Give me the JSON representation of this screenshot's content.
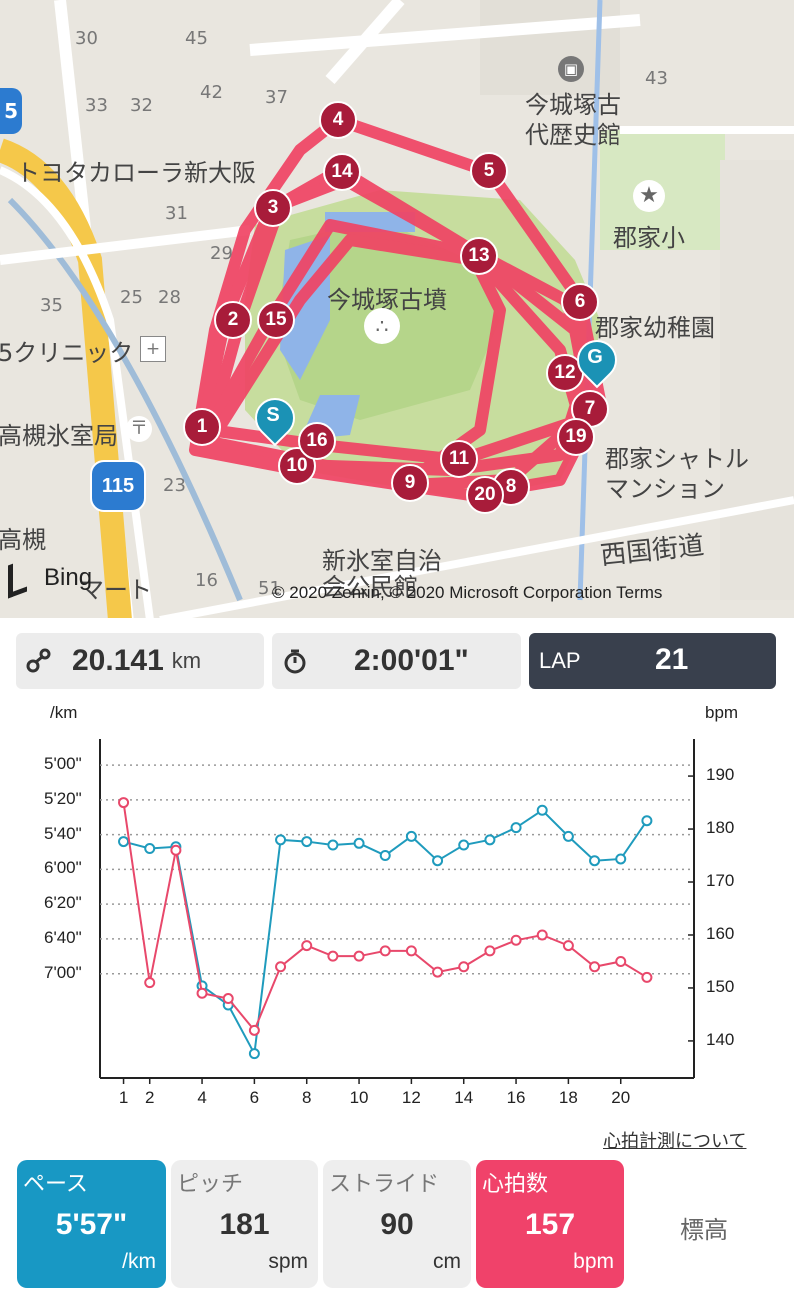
{
  "map": {
    "labels": {
      "num_30": "30",
      "num_45": "45",
      "num_43": "43",
      "num_33": "33",
      "num_32": "32",
      "num_42": "42",
      "num_37": "37",
      "num_31": "31",
      "num_29": "29",
      "num_35": "35",
      "num_25": "25",
      "num_28": "28",
      "num_23": "23",
      "num_16": "16",
      "num_51": "51",
      "num_5": "5",
      "toyota": "トヨタカローラ新大阪",
      "museum": "今城塚古\n代歴史館",
      "kofun": "今城塚古墳",
      "school": "郡家小",
      "kindergarten": "郡家幼稚園",
      "clinic": "5クリニック",
      "post": "高槻氷室局",
      "shuttle": "郡家シャトル\nマンション",
      "saigoku": "西国街道",
      "jichikai": "新氷室自治\n会公民館",
      "mart": "マート",
      "takatsuki": "高槻",
      "route": "115"
    },
    "bing": "Bing",
    "copyright": "© 2020 Zenrin, © 2020 Microsoft Corporation  Terms",
    "markers": [
      "1",
      "2",
      "3",
      "4",
      "5",
      "6",
      "7",
      "8",
      "9",
      "10",
      "11",
      "12",
      "13",
      "14",
      "15",
      "16",
      "19",
      "20"
    ],
    "start_label": "S",
    "goal_label": "G"
  },
  "stats": {
    "distance_icon": "route-icon",
    "distance": "20.141",
    "distance_unit": "km",
    "time_icon": "stopwatch-icon",
    "time": "2:00'01\"",
    "lap_label": "LAP",
    "lap_value": "21"
  },
  "chart_data": {
    "type": "line",
    "left_unit": "/km",
    "right_unit": "bpm",
    "left_ticks": [
      "5'00\"",
      "5'20\"",
      "5'40\"",
      "6'00\"",
      "6'20\"",
      "6'40\"",
      "7'00\""
    ],
    "right_ticks": [
      "190",
      "180",
      "170",
      "160",
      "150",
      "140"
    ],
    "x_ticks": [
      "1",
      "2",
      "4",
      "6",
      "8",
      "10",
      "12",
      "14",
      "16",
      "18",
      "20"
    ],
    "x": [
      1,
      2,
      3,
      4,
      5,
      6,
      7,
      8,
      9,
      10,
      11,
      12,
      13,
      14,
      15,
      16,
      17,
      18,
      19,
      20,
      21
    ],
    "series": [
      {
        "color": "#1f9bbd",
        "axis": "left",
        "values": [
          344,
          348,
          347,
          427,
          438,
          466,
          343,
          344,
          346,
          345,
          352,
          341,
          355,
          346,
          343,
          336,
          326,
          341,
          355,
          354,
          332
        ]
      },
      {
        "color": "#e8486b",
        "axis": "right",
        "values": [
          185,
          151,
          176,
          149,
          148,
          142,
          154,
          158,
          156,
          156,
          157,
          157,
          153,
          154,
          157,
          159,
          160,
          158,
          154,
          155,
          152
        ]
      }
    ],
    "left_range": [
      285,
      480
    ],
    "right_range": [
      133,
      197
    ]
  },
  "link": "心拍計測について",
  "tiles": {
    "pace": {
      "label": "ペース",
      "value": "5'57\"",
      "unit": "/km"
    },
    "pitch": {
      "label": "ピッチ",
      "value": "181",
      "unit": "spm"
    },
    "stride": {
      "label": "ストライド",
      "value": "90",
      "unit": "cm"
    },
    "hr": {
      "label": "心拍数",
      "value": "157",
      "unit": "bpm"
    },
    "elevation": {
      "label": "標高"
    }
  },
  "colors": {
    "pace": "#1898c4",
    "hr": "#f0426a",
    "lap": "#39404d",
    "route": "#f04464"
  }
}
